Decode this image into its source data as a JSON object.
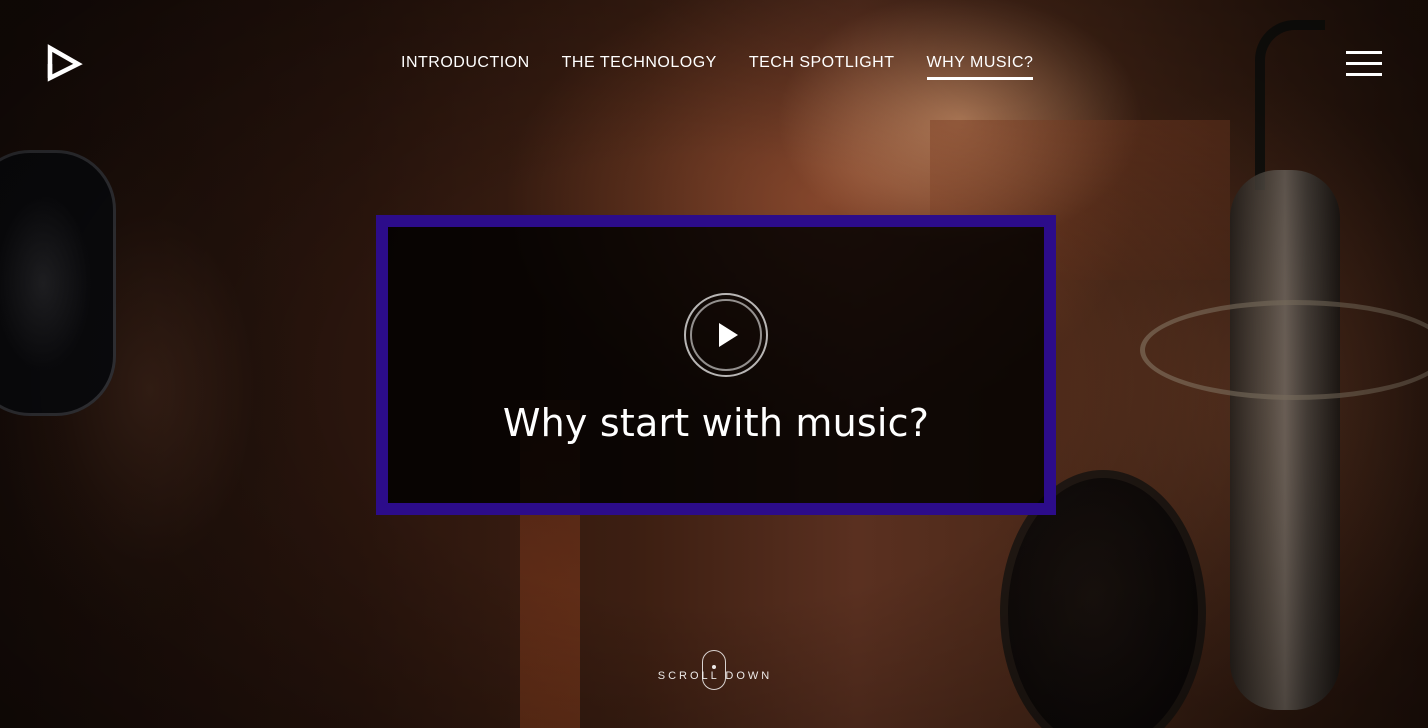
{
  "header": {
    "logo_icon": "play-arrow-logo-icon",
    "nav": [
      {
        "label": "INTRODUCTION",
        "active": false
      },
      {
        "label": "THE TECHNOLOGY",
        "active": false
      },
      {
        "label": "TECH SPOTLIGHT",
        "active": false
      },
      {
        "label": "WHY MUSIC?",
        "active": true
      }
    ],
    "menu_icon": "hamburger-menu-icon"
  },
  "video_card": {
    "title": "Why start with music?",
    "play_icon": "play-icon",
    "border_color": "#2c0c8a"
  },
  "scroll_hint": {
    "label": "SCROLL DOWN",
    "icon": "mouse-scroll-icon"
  },
  "colors": {
    "accent": "#2c0c8a",
    "text": "#ffffff"
  }
}
